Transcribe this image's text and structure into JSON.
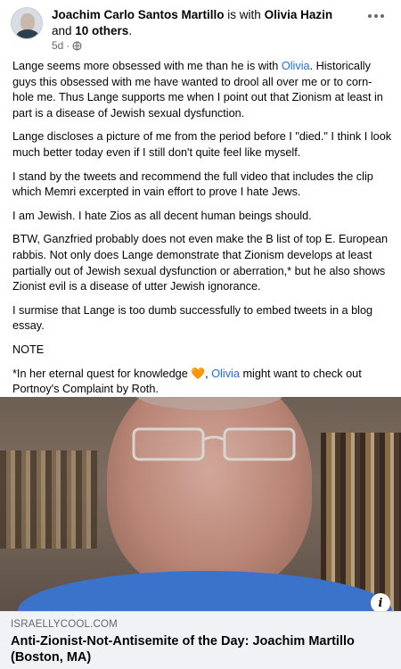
{
  "post": {
    "author": "Joachim Carlo Santos Martillo",
    "with_text": " is with ",
    "tagged": "Olivia Hazin",
    "and_text": " and ",
    "others": "10 others",
    "period": ".",
    "time": "5d",
    "dot": "·",
    "privacy_icon": "globe-icon",
    "more_icon": "more-options-icon"
  },
  "content": {
    "p1_a": "Lange seems more obsessed with me than he is with ",
    "p1_mention": "Olivia",
    "p1_b": ". Historically guys this obsessed with me have wanted to drool all over me or to corn-hole me. Thus Lange supports me when I point out that Zionism at least in part is a disease of Jewish sexual dysfunction.",
    "p2": "Lange discloses a picture of me from the period before I \"died.\" I think I look much better today even if I still don't quite feel like myself.",
    "p3": "I stand by the tweets and recommend the full video that includes the clip which Memri excerpted in vain effort to prove I hate Jews.",
    "p4": "I am Jewish. I hate Zios as all decent human beings should.",
    "p5": "BTW, Ganzfried probably does not even make the B list of top E. European rabbis. Not only does Lange demonstrate that Zionism develops at least partially out of Jewish sexual dysfunction or aberration,* but he also shows Zionist evil is a disease of utter Jewish ignorance.",
    "p6": "I surmise that Lange is too dumb successfully to embed tweets in a blog essay.",
    "p7": "NOTE",
    "p8_a": "*In her eternal quest for knowledge ",
    "p8_emoji": "🧡",
    "p8_sep": ", ",
    "p8_mention": "Olivia",
    "p8_b": " might want to check out Portnoy's Complaint by Roth."
  },
  "link_preview": {
    "domain": "ISRAELLYCOOL.COM",
    "title": "Anti-Zionist-Not-Antisemite of the Day: Joachim Martillo (Boston, MA)",
    "info_icon": "info-icon",
    "info_glyph": "i"
  },
  "colors": {
    "link": "#216fdb",
    "secondary_text": "#65676b",
    "preview_bg": "#f0f2f5"
  }
}
